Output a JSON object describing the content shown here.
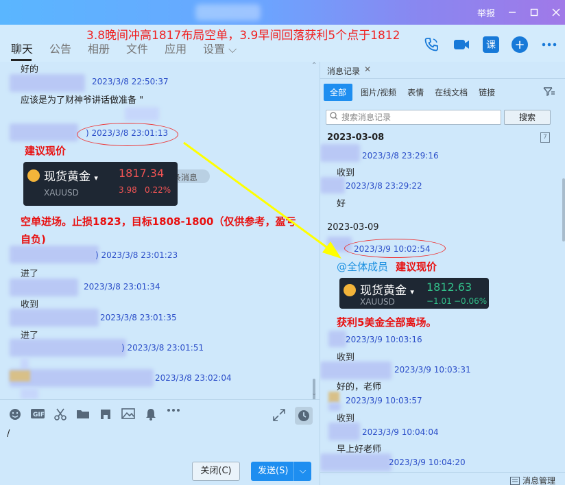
{
  "titlebar": {
    "report_label": "举报",
    "minimize_icon": "minimize-icon",
    "maximize_icon": "maximize-icon",
    "close_icon": "close-icon"
  },
  "annotation_top": "3.8晚间冲高1817布局空单，3.9早间回落获利5个点于1812",
  "tabs": [
    "聊天",
    "公告",
    "相册",
    "文件",
    "应用",
    "设置 ⌵"
  ],
  "toolbar_icons": {
    "phone": "phone-icon",
    "video": "video-icon",
    "course": "课",
    "add": "+",
    "more": "more-icon"
  },
  "chat": {
    "m1_text": "好的",
    "m2_ts": "2023/3/8 22:50:37",
    "m2_text": "应该是为了财神爷讲话做准备 \"",
    "sys_text": "了一条消息",
    "m3_ts": ") 2023/3/8 23:01:13",
    "m3_note": "建议现价",
    "card1": {
      "name": "现货黄金",
      "symbol": "XAUUSD",
      "price": "1817.34",
      "change": "3.98",
      "pct": "0.22%"
    },
    "m3_text1": "空单进场。止损1823，目标1808-1800（仅供参考，盈亏",
    "m3_text2": "自负)",
    "m4_ts": ") 2023/3/8 23:01:23",
    "m4_text": "进了",
    "m5_ts": "2023/3/8 23:01:34",
    "m5_text": "收到",
    "m6_ts": "2023/3/8 23:01:35",
    "m6_text": "进了",
    "m7_ts": ") 2023/3/8 23:01:51",
    "m8_ts": "2023/3/8 23:02:04"
  },
  "input": {
    "caret": "/",
    "close_button": "关闭(C)",
    "send_button": "发送(S)",
    "send_dropdown": "⌵"
  },
  "history": {
    "title": "消息记录",
    "tabs": [
      "全部",
      "图片/视频",
      "表情",
      "在线文档",
      "链接"
    ],
    "search_placeholder": "搜索消息记录",
    "search_button": "搜索",
    "date1": "2023-03-08",
    "h1_ts": "2023/3/8 23:29:16",
    "h1_text": "收到",
    "h2_ts": "2023/3/8 23:29:22",
    "h2_text": "好",
    "date2": "2023-03-09",
    "h3_ts": "2023/3/9 10:02:54",
    "h3_at": "@全体成员",
    "h3_note": "建议现价",
    "card2": {
      "name": "现货黄金",
      "symbol": "XAUUSD",
      "price": "1812.63",
      "change": "−1.01",
      "pct": "−0.06%"
    },
    "h3_text": "获利5美金全部离场。",
    "h4_ts": "2023/3/9 10:03:16",
    "h4_text": "收到",
    "h5_ts": "2023/3/9 10:03:31",
    "h5_text": "好的，老师",
    "h6_ts": "2023/3/9 10:03:57",
    "h6_text": "收到",
    "h7_ts": "2023/3/9 10:04:04",
    "h7_text": "早上好老师",
    "h8_ts": "2023/3/9 10:04:20",
    "manage_label": "消息管理",
    "calendar_icon": "7"
  },
  "colors": {
    "accent": "#1e8ef0",
    "timestamp": "#2a4dc8",
    "annotation": "#e81010",
    "arrow": "#ffff00"
  }
}
